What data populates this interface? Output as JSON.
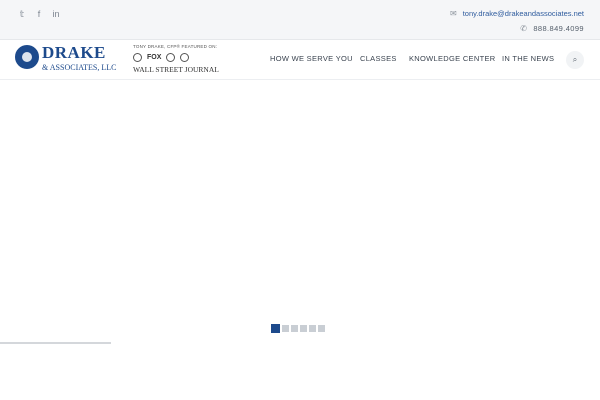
{
  "topbar": {
    "social": [
      {
        "name": "twitter",
        "glyph": "𝕥"
      },
      {
        "name": "facebook",
        "glyph": "f"
      },
      {
        "name": "linkedin",
        "glyph": "in"
      }
    ],
    "email": "tony.drake@drakeandassociates.net",
    "phone": "888.849.4099"
  },
  "header": {
    "logo_name": "DRAKE",
    "logo_sub": "& ASSOCIATES, LLC",
    "featured_label": "TONY DRAKE, CFP® FEATURED ON:",
    "featured_fox": "FOX",
    "featured_wsj": "WALL STREET JOURNAL",
    "nav": [
      "HOW WE SERVE YOU",
      "CLASSES",
      "KNOWLEDGE CENTER",
      "IN THE NEWS"
    ]
  },
  "slider": {
    "slide_count": 6,
    "active_slide": 1
  },
  "colors": {
    "brand": "#1d4a8c",
    "link": "#2f5c9e",
    "topbar_bg": "#f5f6f8"
  }
}
